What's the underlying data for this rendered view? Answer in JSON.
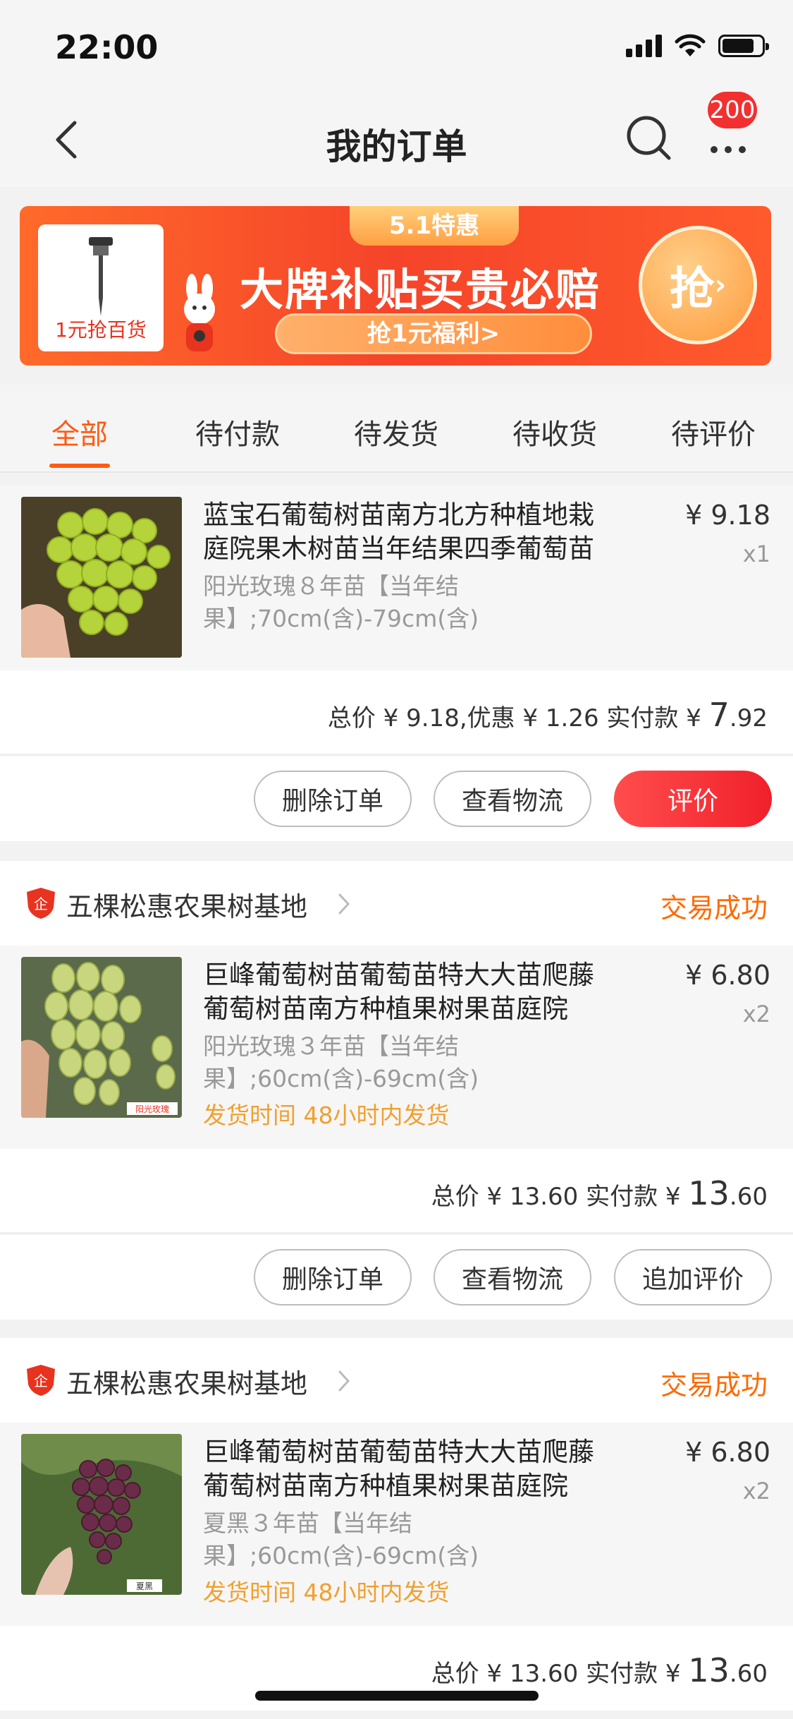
{
  "status_bar": {
    "time": "22:00"
  },
  "nav": {
    "title": "我的订单",
    "badge": "200"
  },
  "banner": {
    "thumb_label": "1元抢百货",
    "tag": "5.1特惠",
    "headline": "大牌补贴买贵必赔",
    "sub": "抢1元福利>",
    "grab": "抢"
  },
  "tabs": [
    "全部",
    "待付款",
    "待发货",
    "待收货",
    "待评价"
  ],
  "orders": [
    {
      "title": "蓝宝石葡萄树苗南方北方种植地栽庭院果木树苗当年结果四季葡萄苗",
      "spec": "阳光玫瑰８年苗【当年结果】;70cm(含)-79cm(含)",
      "price": "¥ 9.18",
      "qty": "x1",
      "total_prefix": "总价 ¥ 9.18,优惠 ¥ 1.26 实付款 ¥ ",
      "total_int": "7",
      "total_dec": ".92",
      "buttons": [
        "删除订单",
        "查看物流",
        "评价"
      ]
    },
    {
      "shop": "五棵松惠农果树基地",
      "status": "交易成功",
      "title": "巨峰葡萄树苗葡萄苗特大大苗爬藤葡萄树苗南方种植果树果苗庭院",
      "spec": "阳光玫瑰３年苗【当年结果】;60cm(含)-69cm(含)",
      "ship": "发货时间 48小时内发货",
      "price": "¥ 6.80",
      "qty": "x2",
      "total_prefix": "总价 ¥ 13.60 实付款 ¥ ",
      "total_int": "13",
      "total_dec": ".60",
      "buttons": [
        "删除订单",
        "查看物流",
        "追加评价"
      ]
    },
    {
      "shop": "五棵松惠农果树基地",
      "status": "交易成功",
      "title": "巨峰葡萄树苗葡萄苗特大大苗爬藤葡萄树苗南方种植果树果苗庭院",
      "spec": "夏黑３年苗【当年结果】;60cm(含)-69cm(含)",
      "ship": "发货时间 48小时内发货",
      "price": "¥ 6.80",
      "qty": "x2",
      "total_prefix": "总价 ¥ 13.60 实付款 ¥ ",
      "total_int": "13",
      "total_dec": ".60"
    }
  ],
  "image_labels": {
    "grape2": "阳光玫瑰",
    "grape3": "夏黑"
  },
  "colors": {
    "accent": "#ff5b14",
    "status": "#ff6a00",
    "primary_button": "#f0202a"
  }
}
